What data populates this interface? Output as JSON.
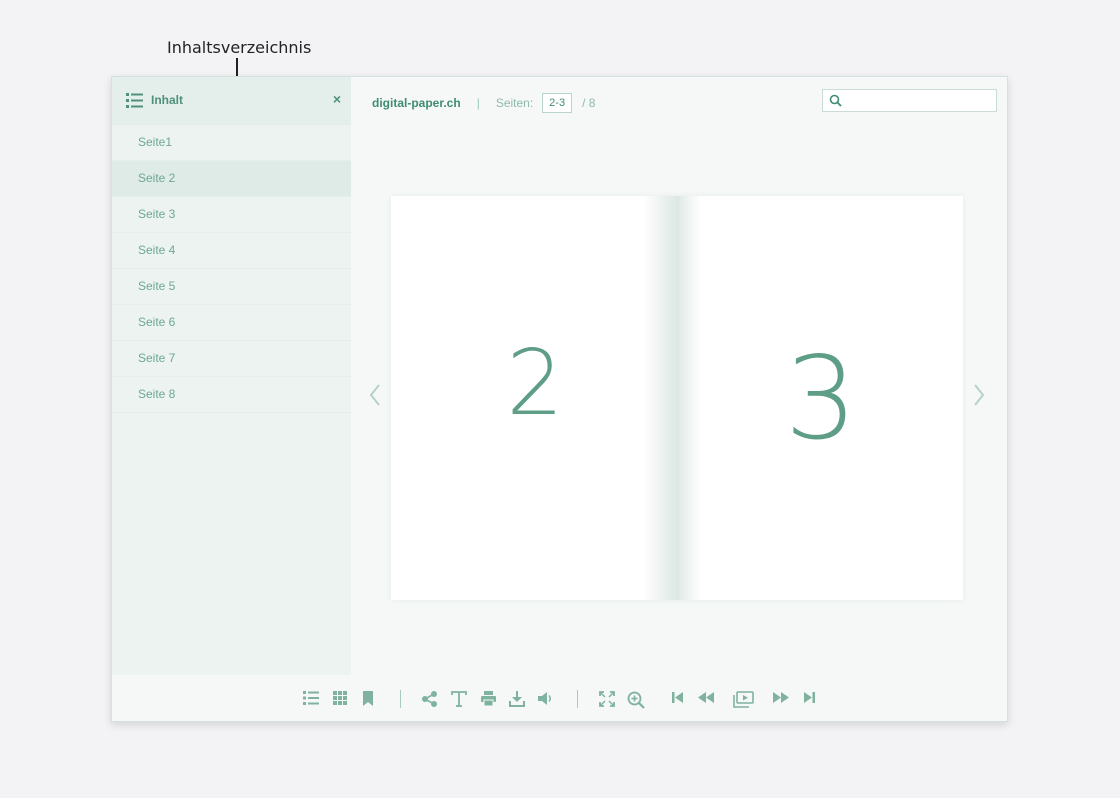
{
  "annotation": {
    "label": "Inhaltsverzeichnis"
  },
  "sidebar": {
    "title": "Inhalt",
    "close_symbol": "×",
    "items": [
      {
        "label": "Seite1"
      },
      {
        "label": "Seite 2",
        "active": true
      },
      {
        "label": "Seite 3"
      },
      {
        "label": "Seite 4"
      },
      {
        "label": "Seite 5"
      },
      {
        "label": "Seite 6"
      },
      {
        "label": "Seite 7"
      },
      {
        "label": "Seite 8"
      }
    ]
  },
  "header": {
    "brand": "digital-paper.ch",
    "separator": "|",
    "pages_label": "Seiten:",
    "current_pages": "2-3",
    "total_pages": "/ 8"
  },
  "search": {
    "placeholder": ""
  },
  "book": {
    "left_page_number": "2",
    "right_page_number": "3"
  },
  "toolbar": {
    "icons": [
      "list-icon",
      "grid-icon",
      "bookmark-icon",
      "share-icon",
      "text-icon",
      "print-icon",
      "download-icon",
      "sound-icon",
      "fullscreen-icon",
      "zoom-in-icon",
      "first-page-icon",
      "previous-page-icon",
      "slideshow-icon",
      "next-page-icon",
      "last-page-icon"
    ]
  },
  "colors": {
    "accent": "#4f917a",
    "light_accent": "#8fbaa9",
    "background": "#f3f3f5",
    "sidebar": "#edf3f0"
  }
}
